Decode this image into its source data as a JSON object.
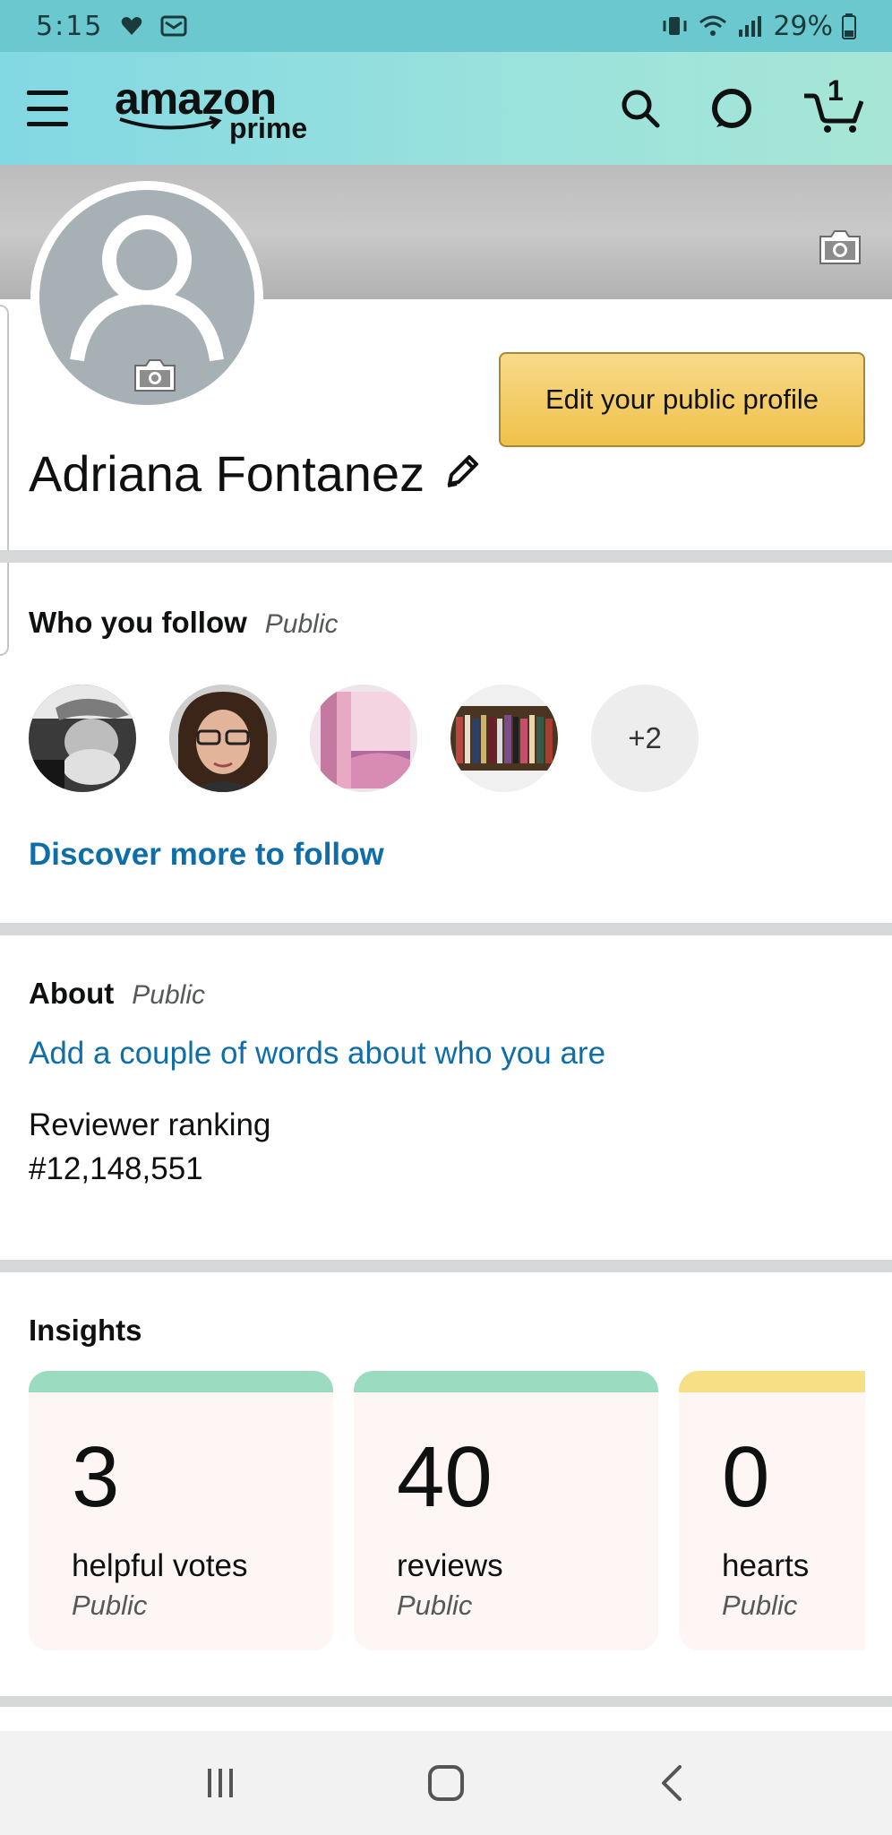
{
  "status_bar": {
    "time": "5:15",
    "battery": "29%",
    "icons": [
      "heart-notification-icon",
      "mail-icon",
      "vibrate-icon",
      "wifi-icon",
      "signal-icon",
      "battery-icon"
    ]
  },
  "header": {
    "logo_amazon": "amazon",
    "logo_prime": "prime",
    "cart_count": "1",
    "icons": [
      "menu-icon",
      "search-icon",
      "alexa-icon",
      "cart-icon"
    ]
  },
  "profile": {
    "name": "Adriana Fontanez",
    "edit_button_label": "Edit your public profile"
  },
  "follow_section": {
    "title": "Who you follow",
    "visibility": "Public",
    "more_count": "+2",
    "discover_link": "Discover more to follow"
  },
  "about_section": {
    "title": "About",
    "visibility": "Public",
    "add_words_link": "Add a couple of words about who you are",
    "ranking_label": "Reviewer ranking",
    "ranking_value": "#12,148,551"
  },
  "insights": {
    "title": "Insights",
    "cards": [
      {
        "value": "3",
        "label": "helpful votes",
        "visibility": "Public",
        "accent": "#9bdcc0"
      },
      {
        "value": "40",
        "label": "reviews",
        "visibility": "Public",
        "accent": "#9bdcc0"
      },
      {
        "value": "0",
        "label": "hearts",
        "visibility": "Public",
        "accent": "#f7df85"
      }
    ]
  },
  "colors": {
    "status_bar": "#6cc8cf",
    "header": "#9be2dc",
    "link": "#0f6ea8",
    "button": "#f0c14b"
  }
}
